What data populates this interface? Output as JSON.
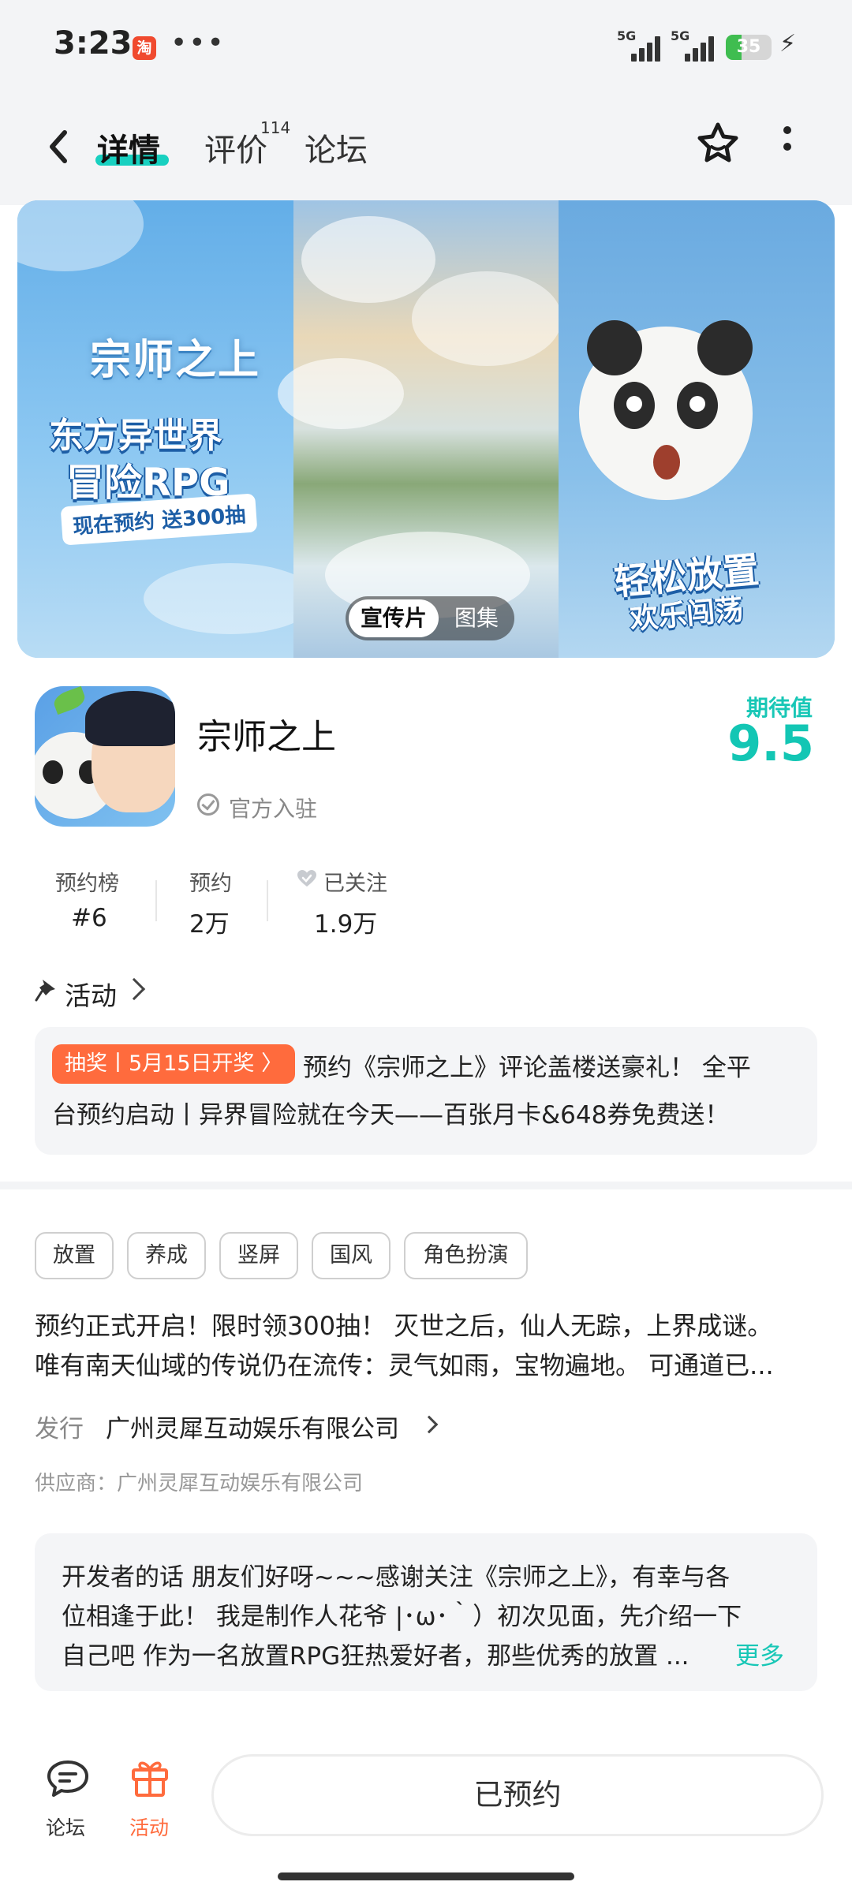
{
  "status_bar": {
    "time": "3:23",
    "app_notification_icon": "淘",
    "dots": "•••",
    "network1": "5G",
    "network2": "5G",
    "battery": "35",
    "battery_level": 0.35
  },
  "header": {
    "tabs": [
      {
        "label": "详情",
        "active": true
      },
      {
        "label": "评价",
        "count": "114"
      },
      {
        "label": "论坛"
      }
    ],
    "accent_color": "#18d0c0"
  },
  "banner": {
    "logo_text": "宗师之上",
    "headline_1": "东方异世界",
    "headline_2": "冒险RPG",
    "pill_text": "现在预约 送300抽",
    "slogan_1": "轻松放置",
    "slogan_2": "欢乐闯荡",
    "media_tabs": [
      {
        "label": "宣传片",
        "selected": true
      },
      {
        "label": "图集",
        "selected": false
      }
    ]
  },
  "app": {
    "name": "宗师之上",
    "official": "官方入驻",
    "score_label": "期待值",
    "score_value": "9.5",
    "score_color": "#13c6b4"
  },
  "stats": [
    {
      "label": "预约榜",
      "value": "#6"
    },
    {
      "label": "预约",
      "value": "2万"
    },
    {
      "label": "已关注",
      "value": "1.9万"
    }
  ],
  "activity": {
    "title": "活动",
    "badge": "抽奖丨5月15日开奖 〉",
    "text_line1": "预约《宗师之上》评论盖楼送豪礼！ 全平",
    "text_line2": "台预约启动丨异界冒险就在今天——百张月卡&648券免费送！",
    "badge_color": "#ff6b3d"
  },
  "tags": [
    "放置",
    "养成",
    "竖屏",
    "国风",
    "角色扮演"
  ],
  "description": {
    "line1": "预约正式开启！限时领300抽！ 灭世之后，仙人无踪，上界成谜。",
    "line2": "唯有南天仙域的传说仍在流传：灵气如雨，宝物遍地。 可通道已..."
  },
  "publisher": {
    "label": "发行",
    "name": "广州灵犀互动娱乐有限公司",
    "supplier": "供应商：广州灵犀互动娱乐有限公司"
  },
  "developer_note": {
    "line1": "开发者的话  朋友们好呀~~~感谢关注《宗师之上》，有幸与各",
    "line2": "位相逢于此！ 我是制作人花爷 |･ω･｀）初次见面，先介绍一下",
    "line3": "自己吧 作为一名放置RPG狂热爱好者，那些优秀的放置 ...",
    "more": "更多"
  },
  "bottom_bar": {
    "forum_label": "论坛",
    "activity_label": "活动",
    "reserve_button": "已预约"
  }
}
